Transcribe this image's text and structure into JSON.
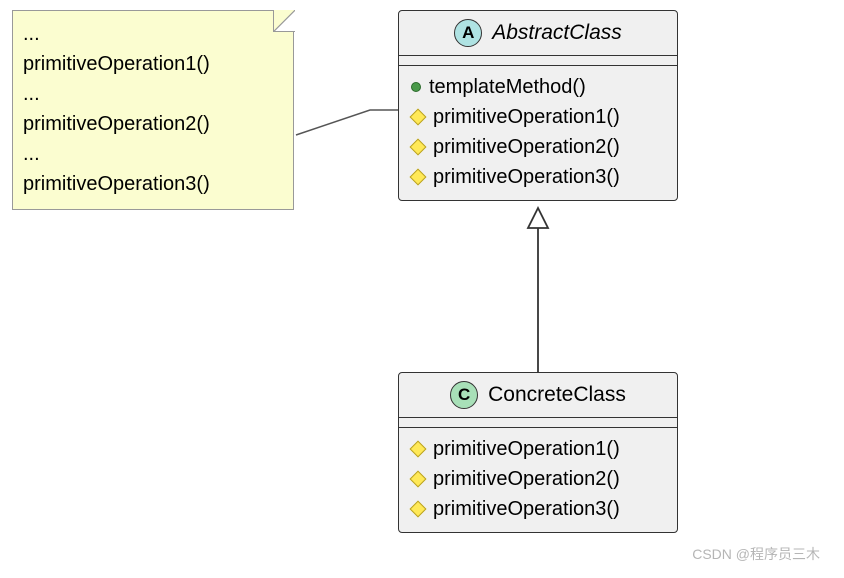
{
  "note": {
    "lines": [
      "...",
      "primitiveOperation1()",
      "...",
      "primitiveOperation2()",
      "...",
      "primitiveOperation3()"
    ]
  },
  "abstractClass": {
    "stereotype": "A",
    "name": "AbstractClass",
    "methods": [
      {
        "icon": "green-circle",
        "label": "templateMethod()"
      },
      {
        "icon": "diamond",
        "label": "primitiveOperation1()"
      },
      {
        "icon": "diamond",
        "label": "primitiveOperation2()"
      },
      {
        "icon": "diamond",
        "label": "primitiveOperation3()"
      }
    ]
  },
  "concreteClass": {
    "stereotype": "C",
    "name": "ConcreteClass",
    "methods": [
      {
        "icon": "diamond",
        "label": "primitiveOperation1()"
      },
      {
        "icon": "diamond",
        "label": "primitiveOperation2()"
      },
      {
        "icon": "diamond",
        "label": "primitiveOperation3()"
      }
    ]
  },
  "watermark": "CSDN @程序员三木"
}
